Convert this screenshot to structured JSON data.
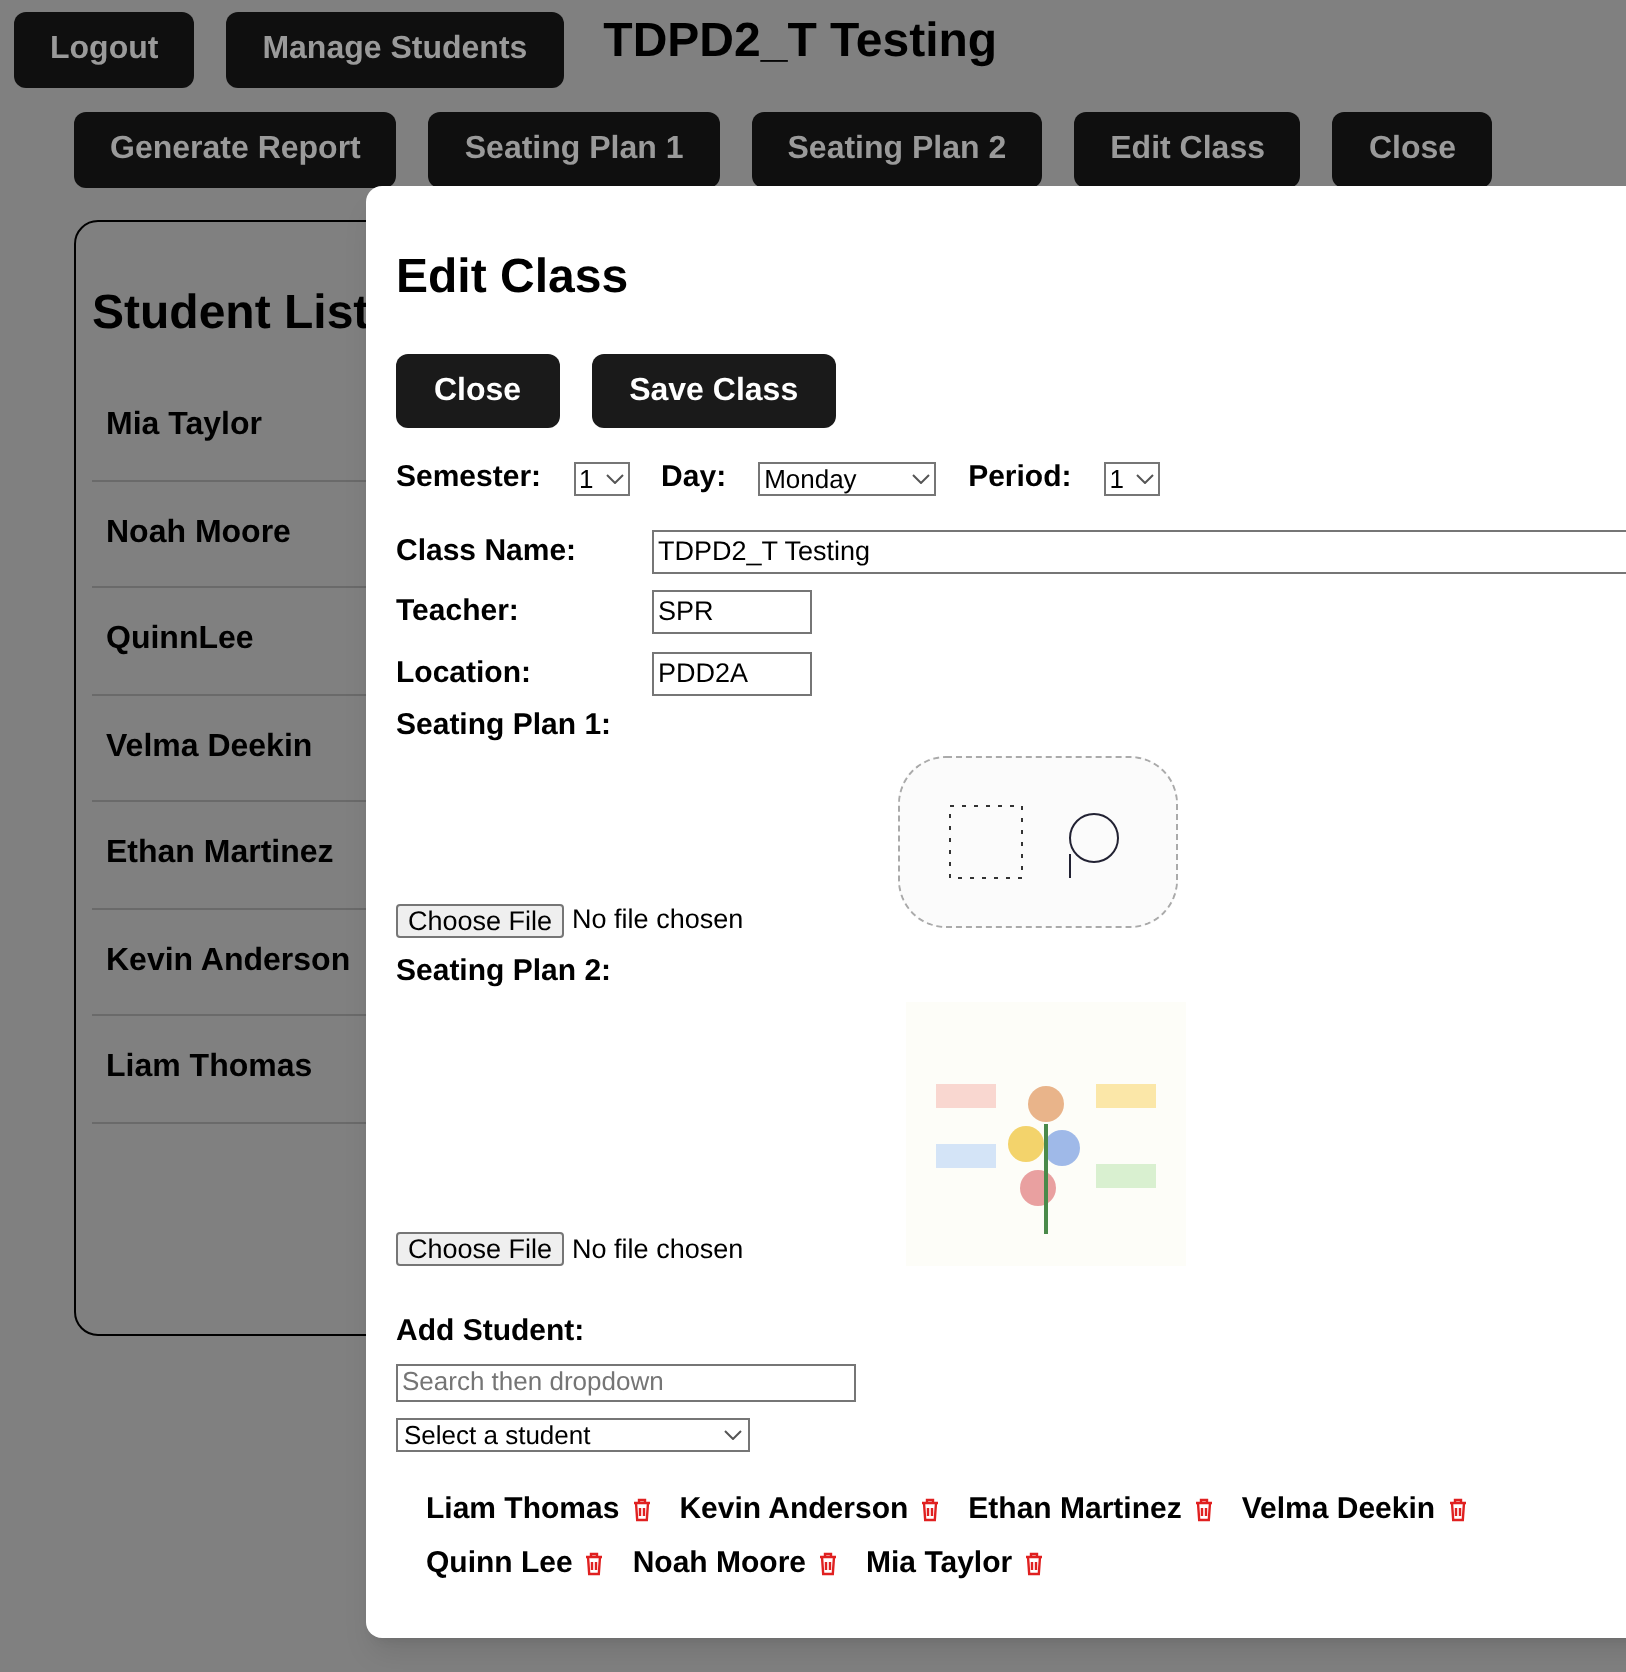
{
  "top_buttons": [
    "Logout",
    "Manage Students"
  ],
  "page_title": "TDPD2_T Testing",
  "toolbar_buttons": [
    "Generate Report",
    "Seating Plan 1",
    "Seating Plan 2",
    "Edit Class",
    "Close"
  ],
  "student_list": {
    "title": "Student List",
    "items": [
      "Mia Taylor",
      "Noah Moore",
      "QuinnLee",
      "Velma Deekin",
      "Ethan Martinez",
      "Kevin Anderson",
      "Liam Thomas"
    ]
  },
  "modal": {
    "title": "Edit Class",
    "buttons": [
      "Close",
      "Save Class"
    ],
    "schedule": [
      {
        "label": "Semester:",
        "value": "1",
        "kind": "short"
      },
      {
        "label": "Day:",
        "value": "Monday",
        "kind": "wide"
      },
      {
        "label": "Period:",
        "value": "1",
        "kind": "short"
      }
    ],
    "fields": [
      {
        "label": "Class Name:",
        "value": "TDPD2_T Testing",
        "kind": "wide"
      },
      {
        "label": "Teacher:",
        "value": "SPR",
        "kind": "short"
      },
      {
        "label": "Location:",
        "value": "PDD2A",
        "kind": "short"
      }
    ],
    "seating_plans": [
      {
        "label": "Seating Plan 1:",
        "file_button": "Choose File",
        "file_status": "No file chosen",
        "kind": "diagram"
      },
      {
        "label": "Seating Plan 2:",
        "file_button": "Choose File",
        "file_status": "No file chosen",
        "kind": "poster"
      }
    ],
    "add_student": {
      "label": "Add Student:",
      "placeholder": "Search then dropdown",
      "select": "Select a student"
    },
    "students": [
      "Liam Thomas",
      "Kevin Anderson",
      "Ethan Martinez",
      "Velma Deekin",
      "Quinn Lee",
      "Noah Moore",
      "Mia Taylor"
    ]
  }
}
